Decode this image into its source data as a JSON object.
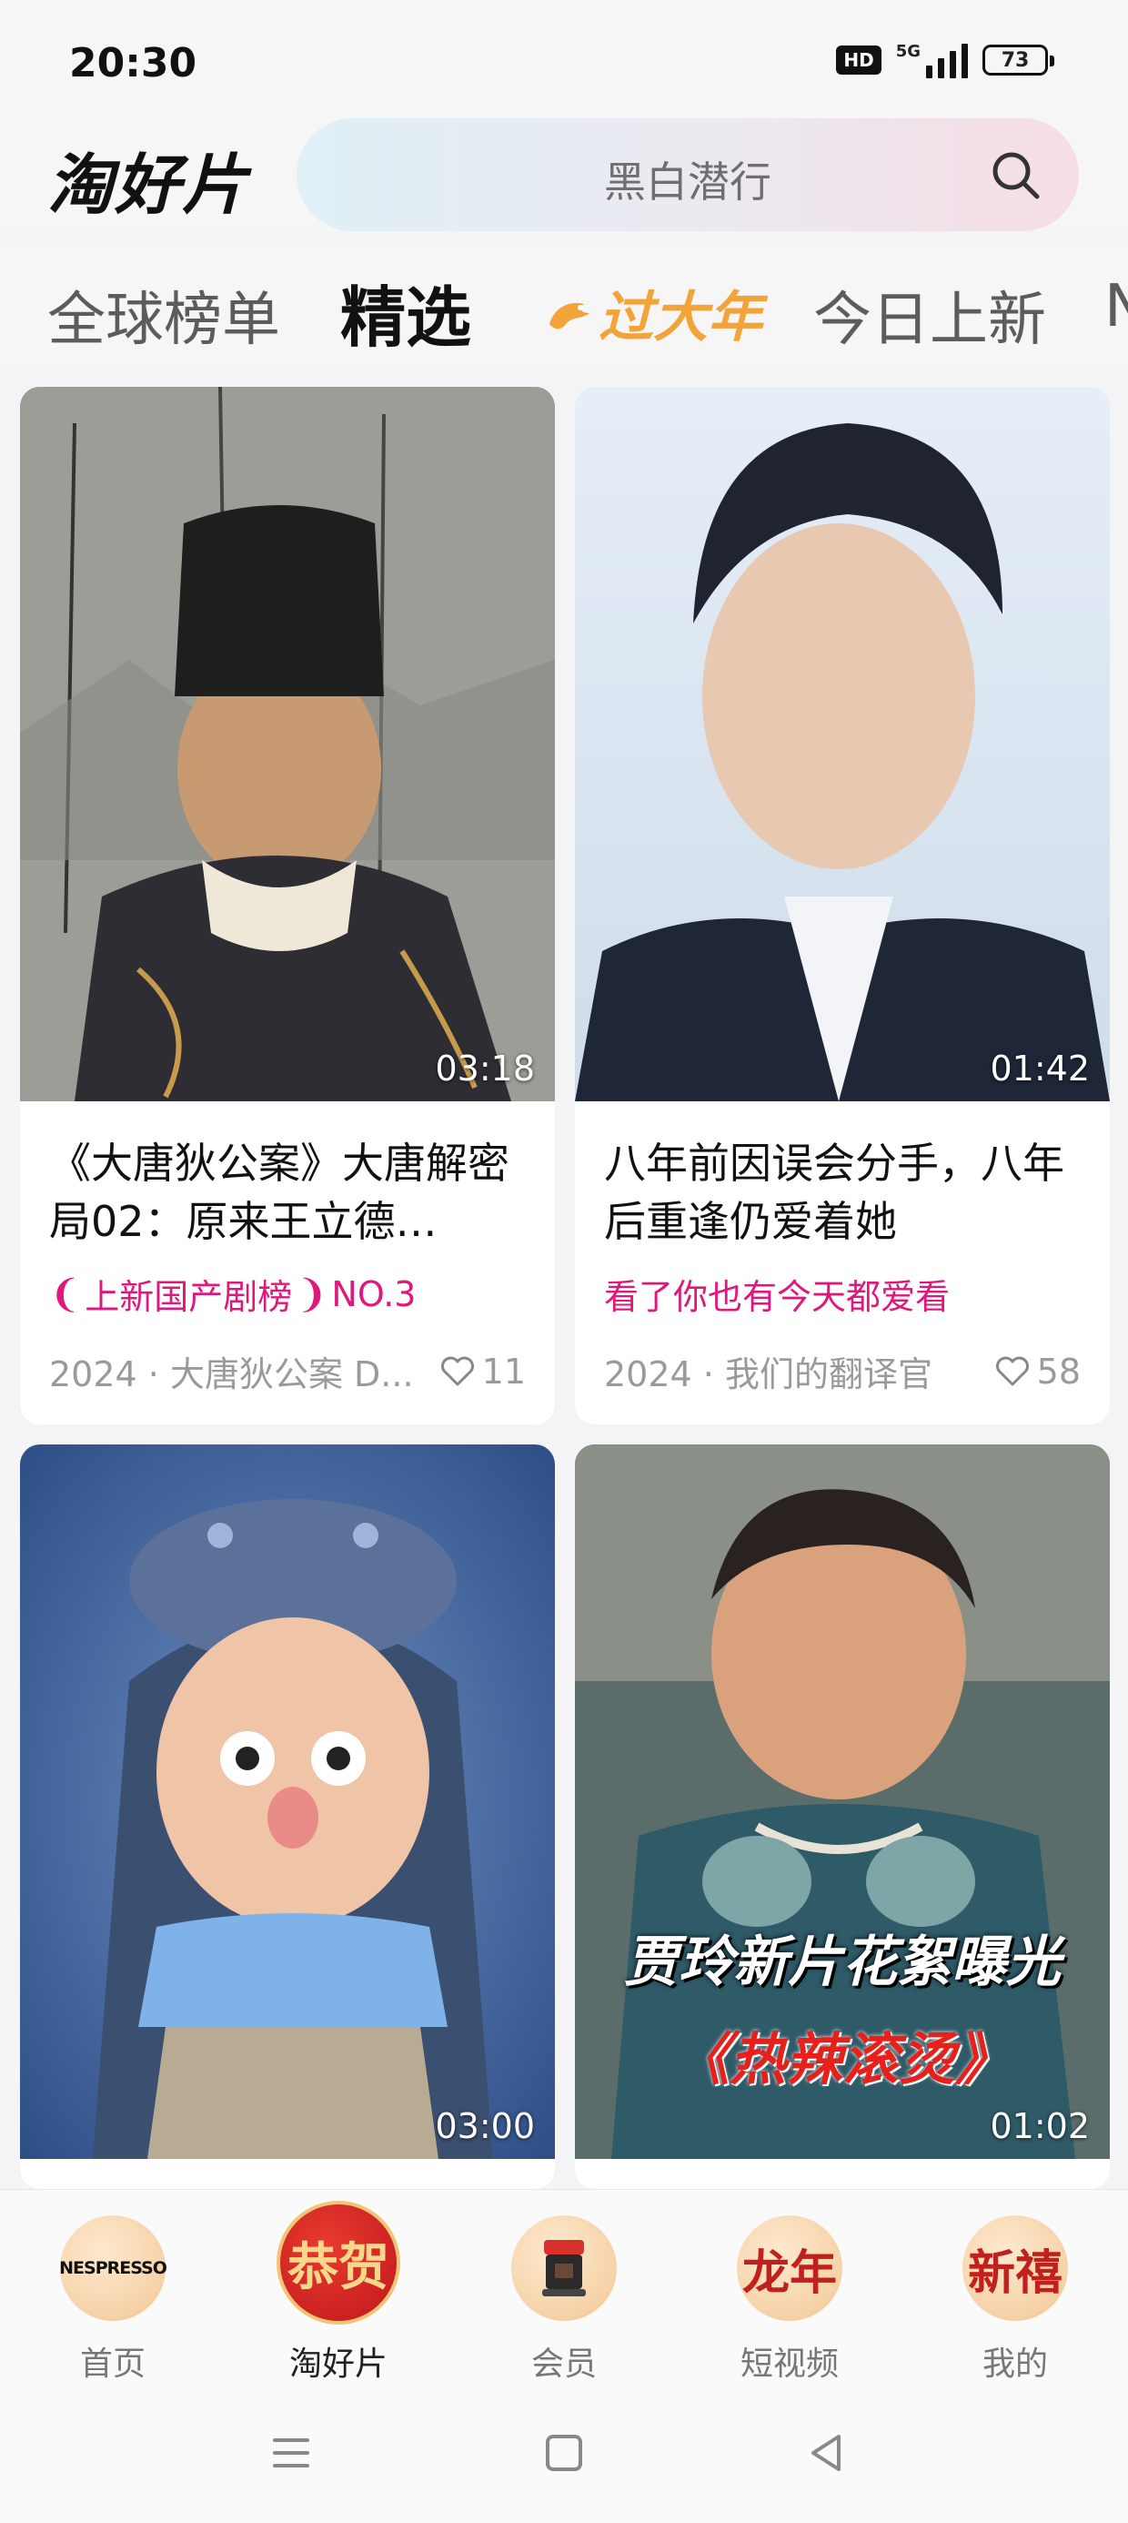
{
  "status_bar": {
    "time": "20:30",
    "hd_label": "HD",
    "network": "5G",
    "battery": "73"
  },
  "header": {
    "logo": "淘好片",
    "search_placeholder": "黑白潜行",
    "search_icon": "search-icon"
  },
  "tabs": [
    {
      "label": "全球榜单"
    },
    {
      "label": "精选"
    },
    {
      "label": "过大年"
    },
    {
      "label": "今日上新"
    },
    {
      "label": "N"
    }
  ],
  "feed": {
    "cards": [
      {
        "duration": "03:18",
        "title": "《大唐狄公案》大唐解密局02：原来王立德…",
        "tag": "上新国产剧榜",
        "tag_rank": "NO.3",
        "meta": "2024 · 大唐狄公案 D...",
        "likes": "11"
      },
      {
        "duration": "01:42",
        "title": "八年前因误会分手，八年后重逢仍爱着她",
        "tag": "看了你也有今天都爱看",
        "meta": "2024 · 我们的翻译官",
        "likes": "58"
      },
      {
        "duration": "03:00"
      },
      {
        "duration": "01:02",
        "overlay_line1": "贾玲新片花絮曝光",
        "overlay_line2": "《热辣滚烫》"
      }
    ]
  },
  "bottom_nav": {
    "items": [
      {
        "label": "首页",
        "badge": "NESPRESSO"
      },
      {
        "label": "淘好片",
        "badge": "恭贺"
      },
      {
        "label": "会员"
      },
      {
        "label": "短视频",
        "badge": "龙年"
      },
      {
        "label": "我的",
        "badge": "新禧"
      }
    ]
  },
  "colors": {
    "accent_pink": "#e0187c",
    "festive_orange": "#f2a43a"
  }
}
